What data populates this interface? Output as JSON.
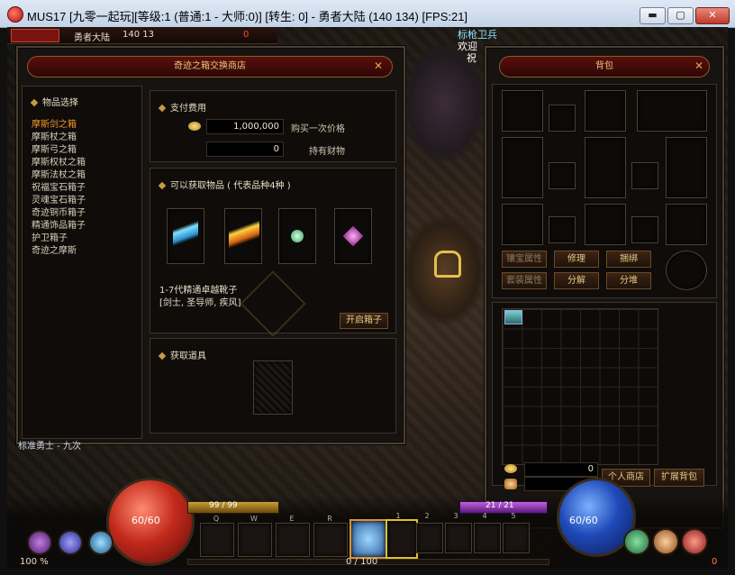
{
  "window": {
    "title": "MUS17 [九零一起玩][等级:1 (普通:1 - 大师:0)] [转生: 0] - 勇者大陆 (140 134) [FPS:21]",
    "minimize": "▬",
    "maximize": "▢",
    "close": "✕"
  },
  "hud_top": {
    "map_name": "勇者大陆",
    "coords_prefix": "140 13",
    "counter": "0"
  },
  "world": {
    "npc_names": [
      "标枪卫兵",
      "欢迎",
      "祝"
    ]
  },
  "shop": {
    "title": "奇迹之箱交换商店",
    "category_header": "物品选择",
    "items": [
      "摩斯剑之箱",
      "摩斯杖之箱",
      "摩斯弓之箱",
      "摩斯权杖之箱",
      "摩斯法杖之箱",
      "祝福宝石箱子",
      "灵魂宝石箱子",
      "奇迹铜币箱子",
      "精通饰品箱子",
      "护卫箱子",
      "奇迹之摩斯"
    ],
    "selected_index": 0,
    "payment": {
      "title": "支付费用",
      "price_value": "1,000,000",
      "price_label": "购买一次价格",
      "holding_value": "0",
      "holding_label": "持有财物"
    },
    "rewards": {
      "title": "可以获取物品 ( 代表品种4种 )",
      "desc_line1": "1-7代精通卓越靴子",
      "desc_line2": "[剑士, 圣导师, 疾风]",
      "open_button": "开启箱子"
    },
    "acquire": {
      "title": "获取道具"
    }
  },
  "inventory": {
    "title": "背包",
    "buttons": {
      "gem_attr": "镶宝属性",
      "repair": "修理",
      "bind": "捆绑",
      "set_attr": "套装属性",
      "decompose": "分解",
      "stack": "分堆",
      "personal_shop": "个人商店",
      "expand_bag": "扩展背包"
    },
    "zen": "0",
    "ruud": "0"
  },
  "hud": {
    "hp": "60/60",
    "mp": "60/60",
    "ag": "99 / 99",
    "sd": "21 / 21",
    "exp": "0  /  100",
    "exp_percent": "100 %",
    "corner_value": "0",
    "skill_keys": [
      "Q",
      "W",
      "E",
      "R"
    ],
    "slot_numbers": [
      "1",
      "2",
      "3",
      "4",
      "5"
    ],
    "bottom_left_text": "标准勇士 - 九次",
    "accent_hp": "#c42a1c",
    "accent_mp": "#1f49b8"
  }
}
